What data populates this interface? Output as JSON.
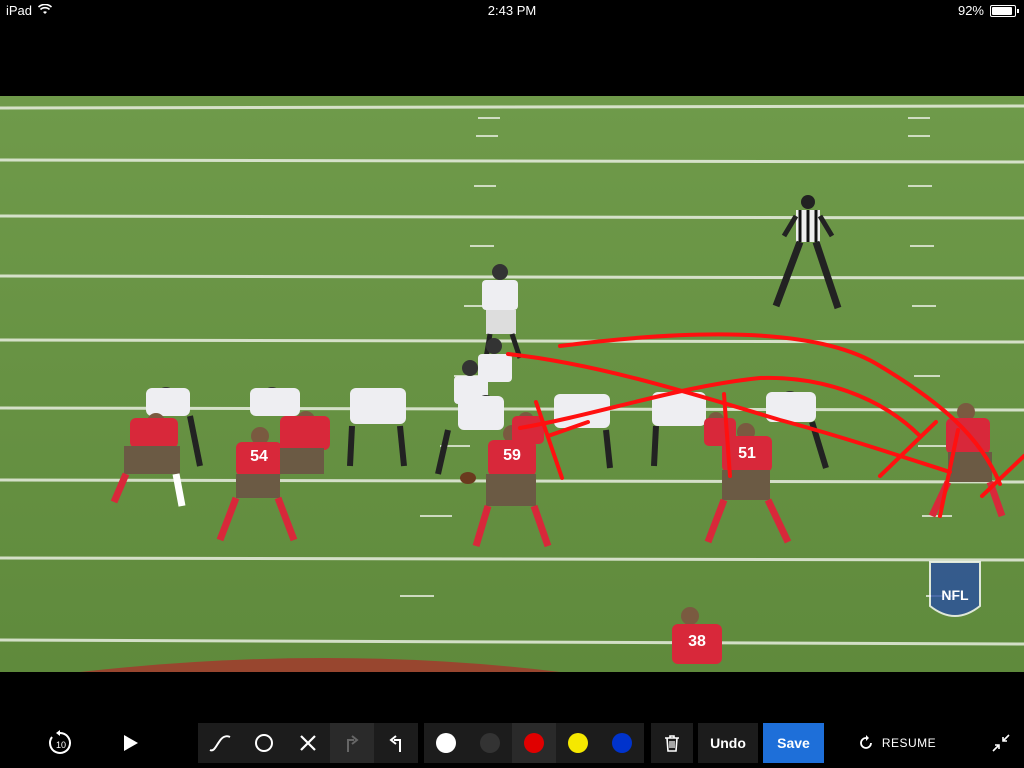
{
  "status_bar": {
    "device": "iPad",
    "time": "2:43 PM",
    "battery": "92%",
    "battery_level": 0.92
  },
  "video": {
    "watermark": "NFL",
    "jersey_numbers": [
      "54",
      "59",
      "51",
      "38"
    ]
  },
  "toolbar": {
    "rewind_label": "10",
    "tools": [
      "freehand-icon",
      "circle-icon",
      "x-icon",
      "redo-icon",
      "undo-arrow-icon"
    ],
    "colors": [
      "#ffffff",
      "#333333",
      "#e00000",
      "#f5e800",
      "#0033cc"
    ],
    "undo_label": "Undo",
    "save_label": "Save",
    "resume_label": "RESUME",
    "accent": "#1e6fd9"
  }
}
